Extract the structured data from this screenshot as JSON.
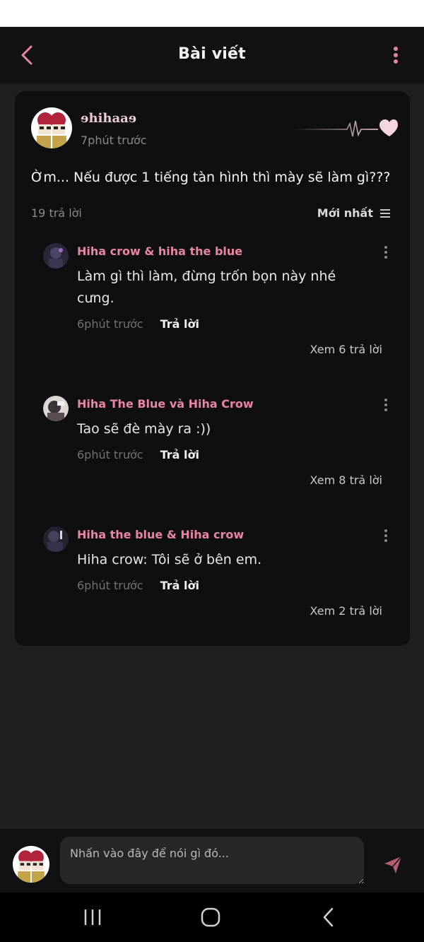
{
  "header": {
    "title": "Bài viết"
  },
  "post": {
    "author": "ɘhihaaɘ",
    "time": "7phút trước",
    "text": "Ờm... Nếu được 1 tiếng tàn hình thì mày sẽ làm gì???",
    "reply_count": "19 trả lời",
    "sort_label": "Mới nhất"
  },
  "comments": [
    {
      "name": "Hiha crow & hiha the blue",
      "text": "Làm gì thì làm, đừng trốn bọn này nhé cưng.",
      "time": "6phút trước",
      "reply_label": "Trả lời",
      "view_replies": "Xem 6 trả lời"
    },
    {
      "name": "Hiha The Blue và Hiha Crow",
      "text": "Tao sẽ đè mày ra :))",
      "time": "6phút trước",
      "reply_label": "Trả lời",
      "view_replies": "Xem 8 trả lời"
    },
    {
      "name": "Hiha the blue & Hiha crow",
      "text": "Hiha crow: Tôi sẽ ở bên em.",
      "time": "6phút trước",
      "reply_label": "Trả lời",
      "view_replies": "Xem 2 trả lời"
    }
  ],
  "composer": {
    "placeholder": "Nhấn vào đây để nói gì đó..."
  },
  "colors": {
    "accent": "#e886a2",
    "background": "#1f1e21",
    "card": "#0f0f11"
  }
}
